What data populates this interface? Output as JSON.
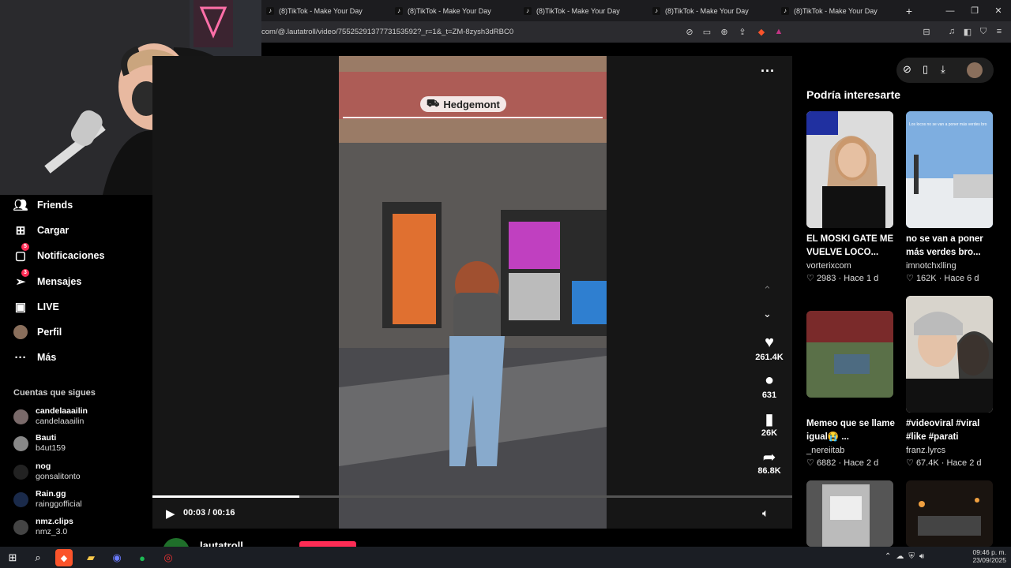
{
  "browser": {
    "tabs": [
      {
        "title": "(8)TikTok - Make Your Day"
      },
      {
        "title": "(8)TikTok - Make Your Day"
      },
      {
        "title": "(8)TikTok - Make Your Day"
      },
      {
        "title": "(8)TikTok - Make Your Day"
      },
      {
        "title": "(8)TikTok - Make Your Day"
      }
    ],
    "new_tab": "+",
    "url": "com/@.lautatroll/video/7552529137773153592?_r=1&_t=ZM-8zysh3dRBC0"
  },
  "sidebar": {
    "nav": [
      {
        "label": "Friends",
        "icon": "friends-icon",
        "badge": ""
      },
      {
        "label": "Cargar",
        "icon": "upload-icon",
        "badge": ""
      },
      {
        "label": "Notificaciones",
        "icon": "inbox-icon",
        "badge": "5"
      },
      {
        "label": "Mensajes",
        "icon": "send-icon",
        "badge": "3"
      },
      {
        "label": "LIVE",
        "icon": "live-icon",
        "badge": ""
      },
      {
        "label": "Perfil",
        "icon": "avatar",
        "badge": ""
      },
      {
        "label": "Más",
        "icon": "more-icon",
        "badge": ""
      }
    ],
    "following_title": "Cuentas que sigues",
    "following": [
      {
        "name": "candelaaailin",
        "handle": "candelaaailin"
      },
      {
        "name": "Bauti",
        "handle": "b4ut159"
      },
      {
        "name": "nog",
        "handle": "gonsalitonto"
      },
      {
        "name": "Rain.gg",
        "handle": "rainggofficial"
      },
      {
        "name": "nmz.clips",
        "handle": "nmz_3.0"
      }
    ]
  },
  "video": {
    "overlay_label": "Hedgemont",
    "time": "00:03 / 00:16",
    "progress": 0.23,
    "author": "lautatroll",
    "actions": [
      {
        "icon": "heart-icon",
        "count": "261.4K"
      },
      {
        "icon": "comment-icon",
        "count": "631"
      },
      {
        "icon": "bookmark-icon",
        "count": "26K"
      },
      {
        "icon": "share-icon",
        "count": "86.8K"
      }
    ]
  },
  "recommend": {
    "title": "Podría interesarte",
    "items": [
      {
        "title": "EL MOSKI GATE ME VUELVE LOCO...",
        "author": "vorterixcom",
        "likes": "2983",
        "age": "Hace 1 d"
      },
      {
        "title": "no se van a poner más verdes bro...",
        "author": "imnotchxlling",
        "likes": "162K",
        "age": "Hace 6 d"
      },
      {
        "title": "Memeo que se llame igual😭 ...",
        "author": "_nereiitab",
        "likes": "6882",
        "age": "Hace 2 d"
      },
      {
        "title": "#videoviral #viral #like #parati",
        "author": "franz.lyrcs",
        "likes": "67.4K",
        "age": "Hace 2 d"
      }
    ],
    "thumb_caption": "Los locos no se van a poner más verdes bro"
  },
  "taskbar": {
    "time": "09:46 p. m.",
    "date": "23/09/2025"
  },
  "colors": {
    "accent": "#fe2c55",
    "bg": "#000000"
  }
}
